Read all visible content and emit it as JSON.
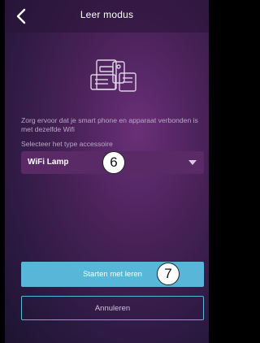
{
  "header": {
    "title": "Leer modus",
    "back_icon": "chevron-left-icon"
  },
  "content": {
    "device_icon": "devices-icon",
    "info_text": "Zorg ervoor dat je smart phone en apparaat verbonden is met dezelfde Wifi",
    "select_label": "Selecteer het type accessoire",
    "select_value": "WiFi Lamp"
  },
  "markers": {
    "select_marker": "6",
    "start_marker": "7"
  },
  "actions": {
    "start_label": "Starten met leren",
    "cancel_label": "Annuleren"
  },
  "colors": {
    "accent": "#58b7d9",
    "select_bg": "#5a2a67"
  }
}
